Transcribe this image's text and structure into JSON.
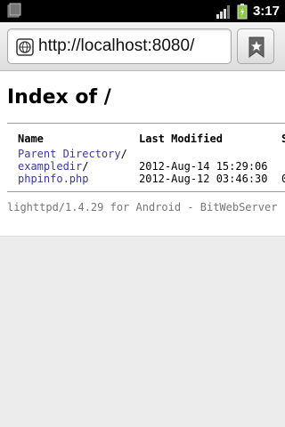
{
  "status_bar": {
    "time": "3:17",
    "icons": [
      "app-icon",
      "signal-icon",
      "battery-icon"
    ]
  },
  "browser": {
    "url": "http://localhost:8080/",
    "icons": [
      "globe-icon",
      "bookmark-icon"
    ]
  },
  "page": {
    "title": "Index of /",
    "columns": [
      "Name",
      "Last Modified",
      "S"
    ],
    "entries": [
      {
        "name": "Parent Directory",
        "suffix": "/",
        "modified": "",
        "size": ""
      },
      {
        "name": "exampledir",
        "suffix": "/",
        "modified": "2012-Aug-14 15:29:06",
        "size": ""
      },
      {
        "name": "phpinfo.php",
        "suffix": "",
        "modified": "2012-Aug-12 03:46:30",
        "size": "0"
      }
    ],
    "footer": "lighttpd/1.4.29 for Android - BitWebServer"
  },
  "colors": {
    "link": "#3a3a99",
    "footer": "#777777",
    "battery": "#8cc63f"
  }
}
